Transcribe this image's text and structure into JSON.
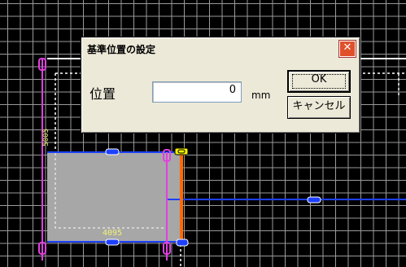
{
  "dialog": {
    "title": "基準位置の設定",
    "close_label": "✕",
    "position_label": "位置",
    "position_value": "0",
    "unit": "mm",
    "ok_label": "OK",
    "cancel_label": "キャンセル"
  },
  "canvas": {
    "height_dimension": "5005",
    "width_dimension": "4095"
  },
  "colors": {
    "background": "#000000",
    "grid": "#9a9a9a",
    "panel_fill": "#a7a7a7",
    "blue_line": "#1e40ff",
    "magenta_line": "#e040e0",
    "orange_edge": "#ff6a00",
    "dimension_text": "#f2f27a",
    "dialog_face": "#ece9d8"
  }
}
